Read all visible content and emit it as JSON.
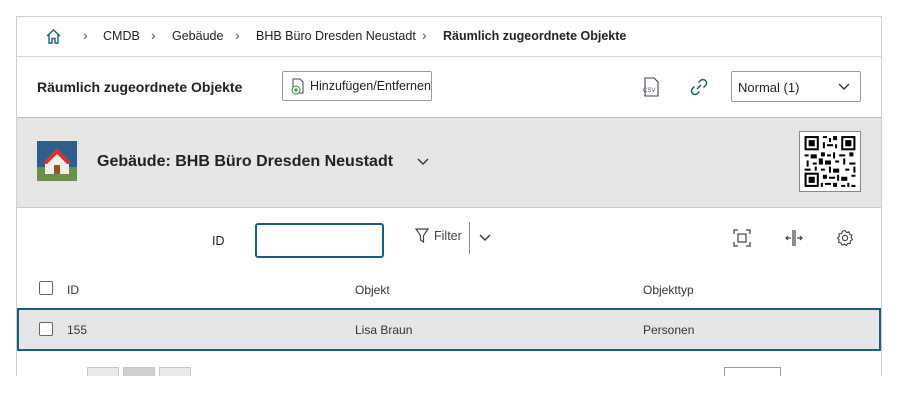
{
  "breadcrumb": {
    "items": [
      "CMDB",
      "Gebäude",
      "BHB Büro Dresden Neustadt",
      "Räumlich zugeordnete Objekte"
    ]
  },
  "toolbar": {
    "title": "Räumlich zugeordnete Objekte",
    "add_remove_label": "Hinzufügen/Entfernen",
    "csv_label": "CSV",
    "view_select": "Normal (1)"
  },
  "object": {
    "name": "Gebäude: BHB Büro Dresden Neustadt"
  },
  "filter": {
    "id_label": "ID",
    "id_value": "",
    "filter_label": "Filter"
  },
  "table": {
    "columns": [
      "ID",
      "Objekt",
      "Objekttyp"
    ],
    "rows": [
      {
        "id": "155",
        "objekt": "Lisa Braun",
        "objekttyp": "Personen"
      }
    ]
  },
  "colors": {
    "accent": "#1a5f7a",
    "header_bg": "#e6e6e6"
  }
}
